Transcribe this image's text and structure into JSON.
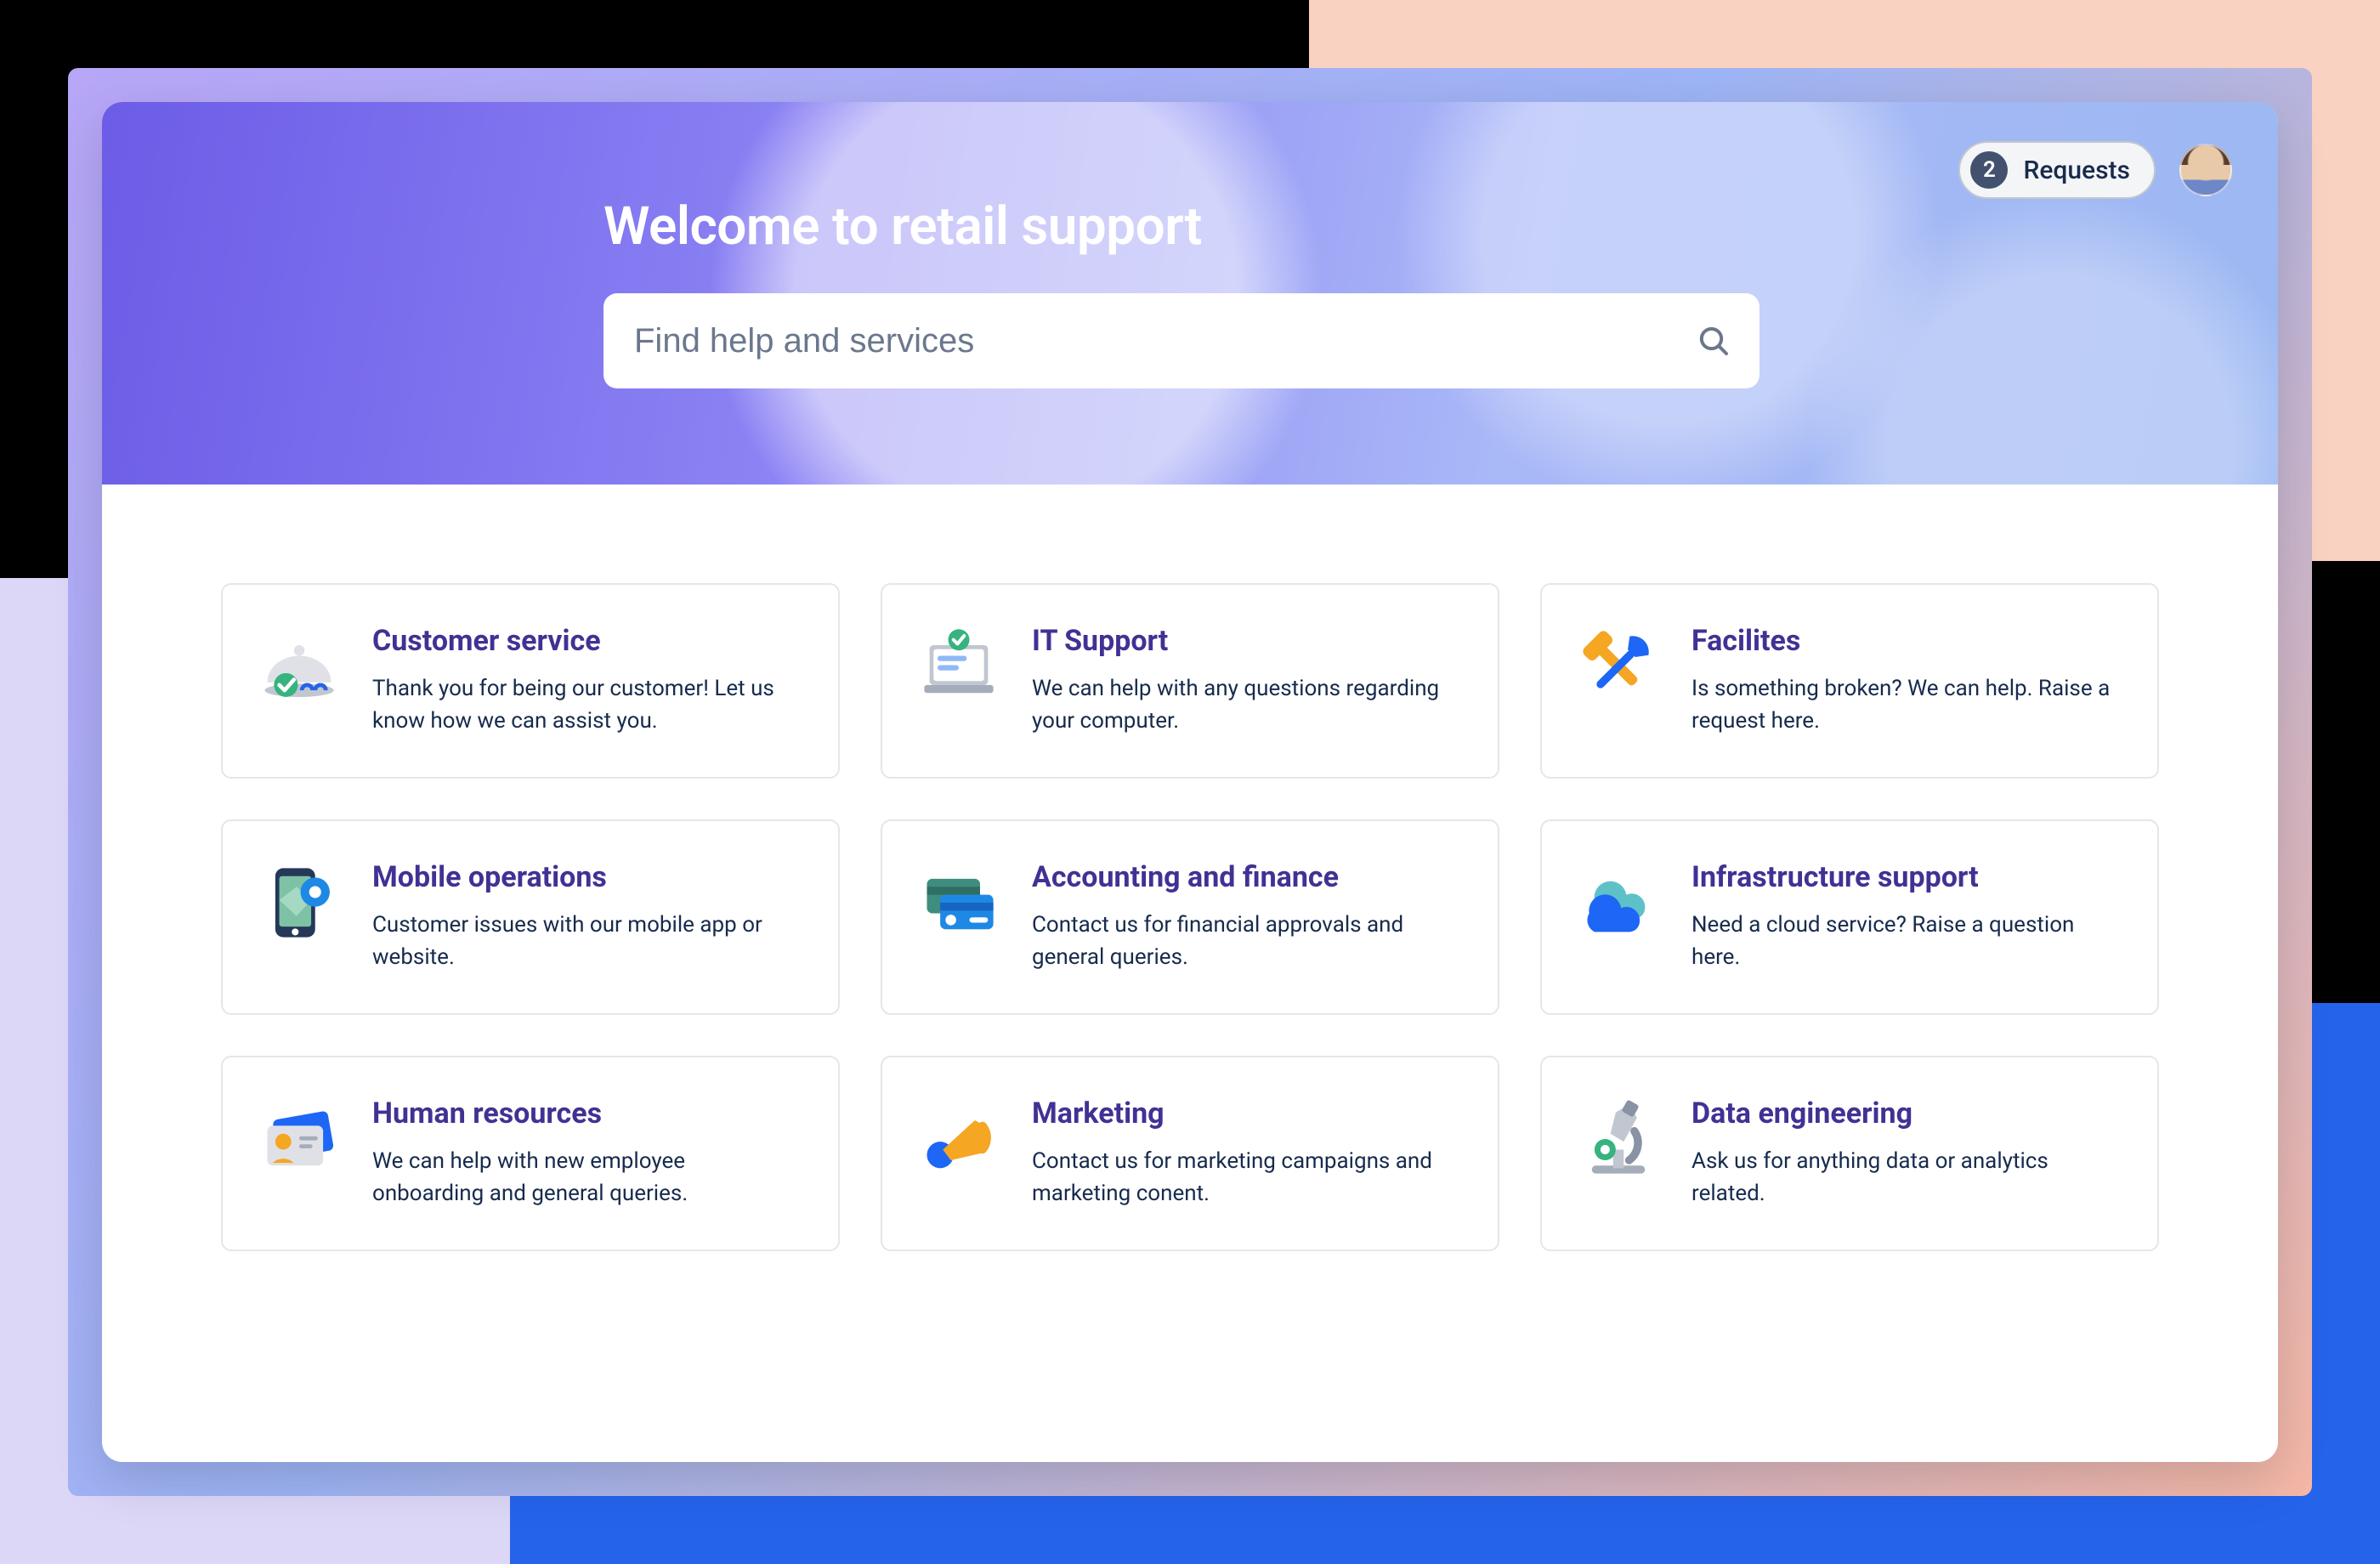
{
  "colors": {
    "heading_purple": "#403294",
    "text_dark": "#172B4D",
    "blue": "#2563EB",
    "amber": "#F5A623"
  },
  "header": {
    "title": "Welcome to retail support",
    "requests_count": "2",
    "requests_label": "Requests"
  },
  "search": {
    "placeholder": "Find help and services",
    "value": ""
  },
  "cards": [
    {
      "id": "customer-service",
      "title": "Customer service",
      "desc": "Thank you for being our customer! Let us know how we can assist you.",
      "icon": "cloche-check-icon"
    },
    {
      "id": "it-support",
      "title": "IT Support",
      "desc": "We can help with any questions regarding your computer.",
      "icon": "laptop-check-icon"
    },
    {
      "id": "facilities",
      "title": "Facilites",
      "desc": "Is something broken? We can help. Raise a request here.",
      "icon": "tools-icon"
    },
    {
      "id": "mobile-operations",
      "title": "Mobile operations",
      "desc": "Customer issues with our mobile app or website.",
      "icon": "mobile-map-icon"
    },
    {
      "id": "accounting-finance",
      "title": "Accounting and finance",
      "desc": "Contact us for financial approvals and general queries.",
      "icon": "credit-cards-icon"
    },
    {
      "id": "infrastructure-support",
      "title": "Infrastructure support",
      "desc": "Need a cloud service? Raise a question here.",
      "icon": "cloud-icon"
    },
    {
      "id": "human-resources",
      "title": "Human resources",
      "desc": "We can help with new employee onboarding and general queries.",
      "icon": "id-card-icon"
    },
    {
      "id": "marketing",
      "title": "Marketing",
      "desc": "Contact us for marketing campaigns and marketing conent.",
      "icon": "megaphone-icon"
    },
    {
      "id": "data-engineering",
      "title": "Data engineering",
      "desc": "Ask us for anything data or analytics related.",
      "icon": "microscope-icon"
    }
  ]
}
